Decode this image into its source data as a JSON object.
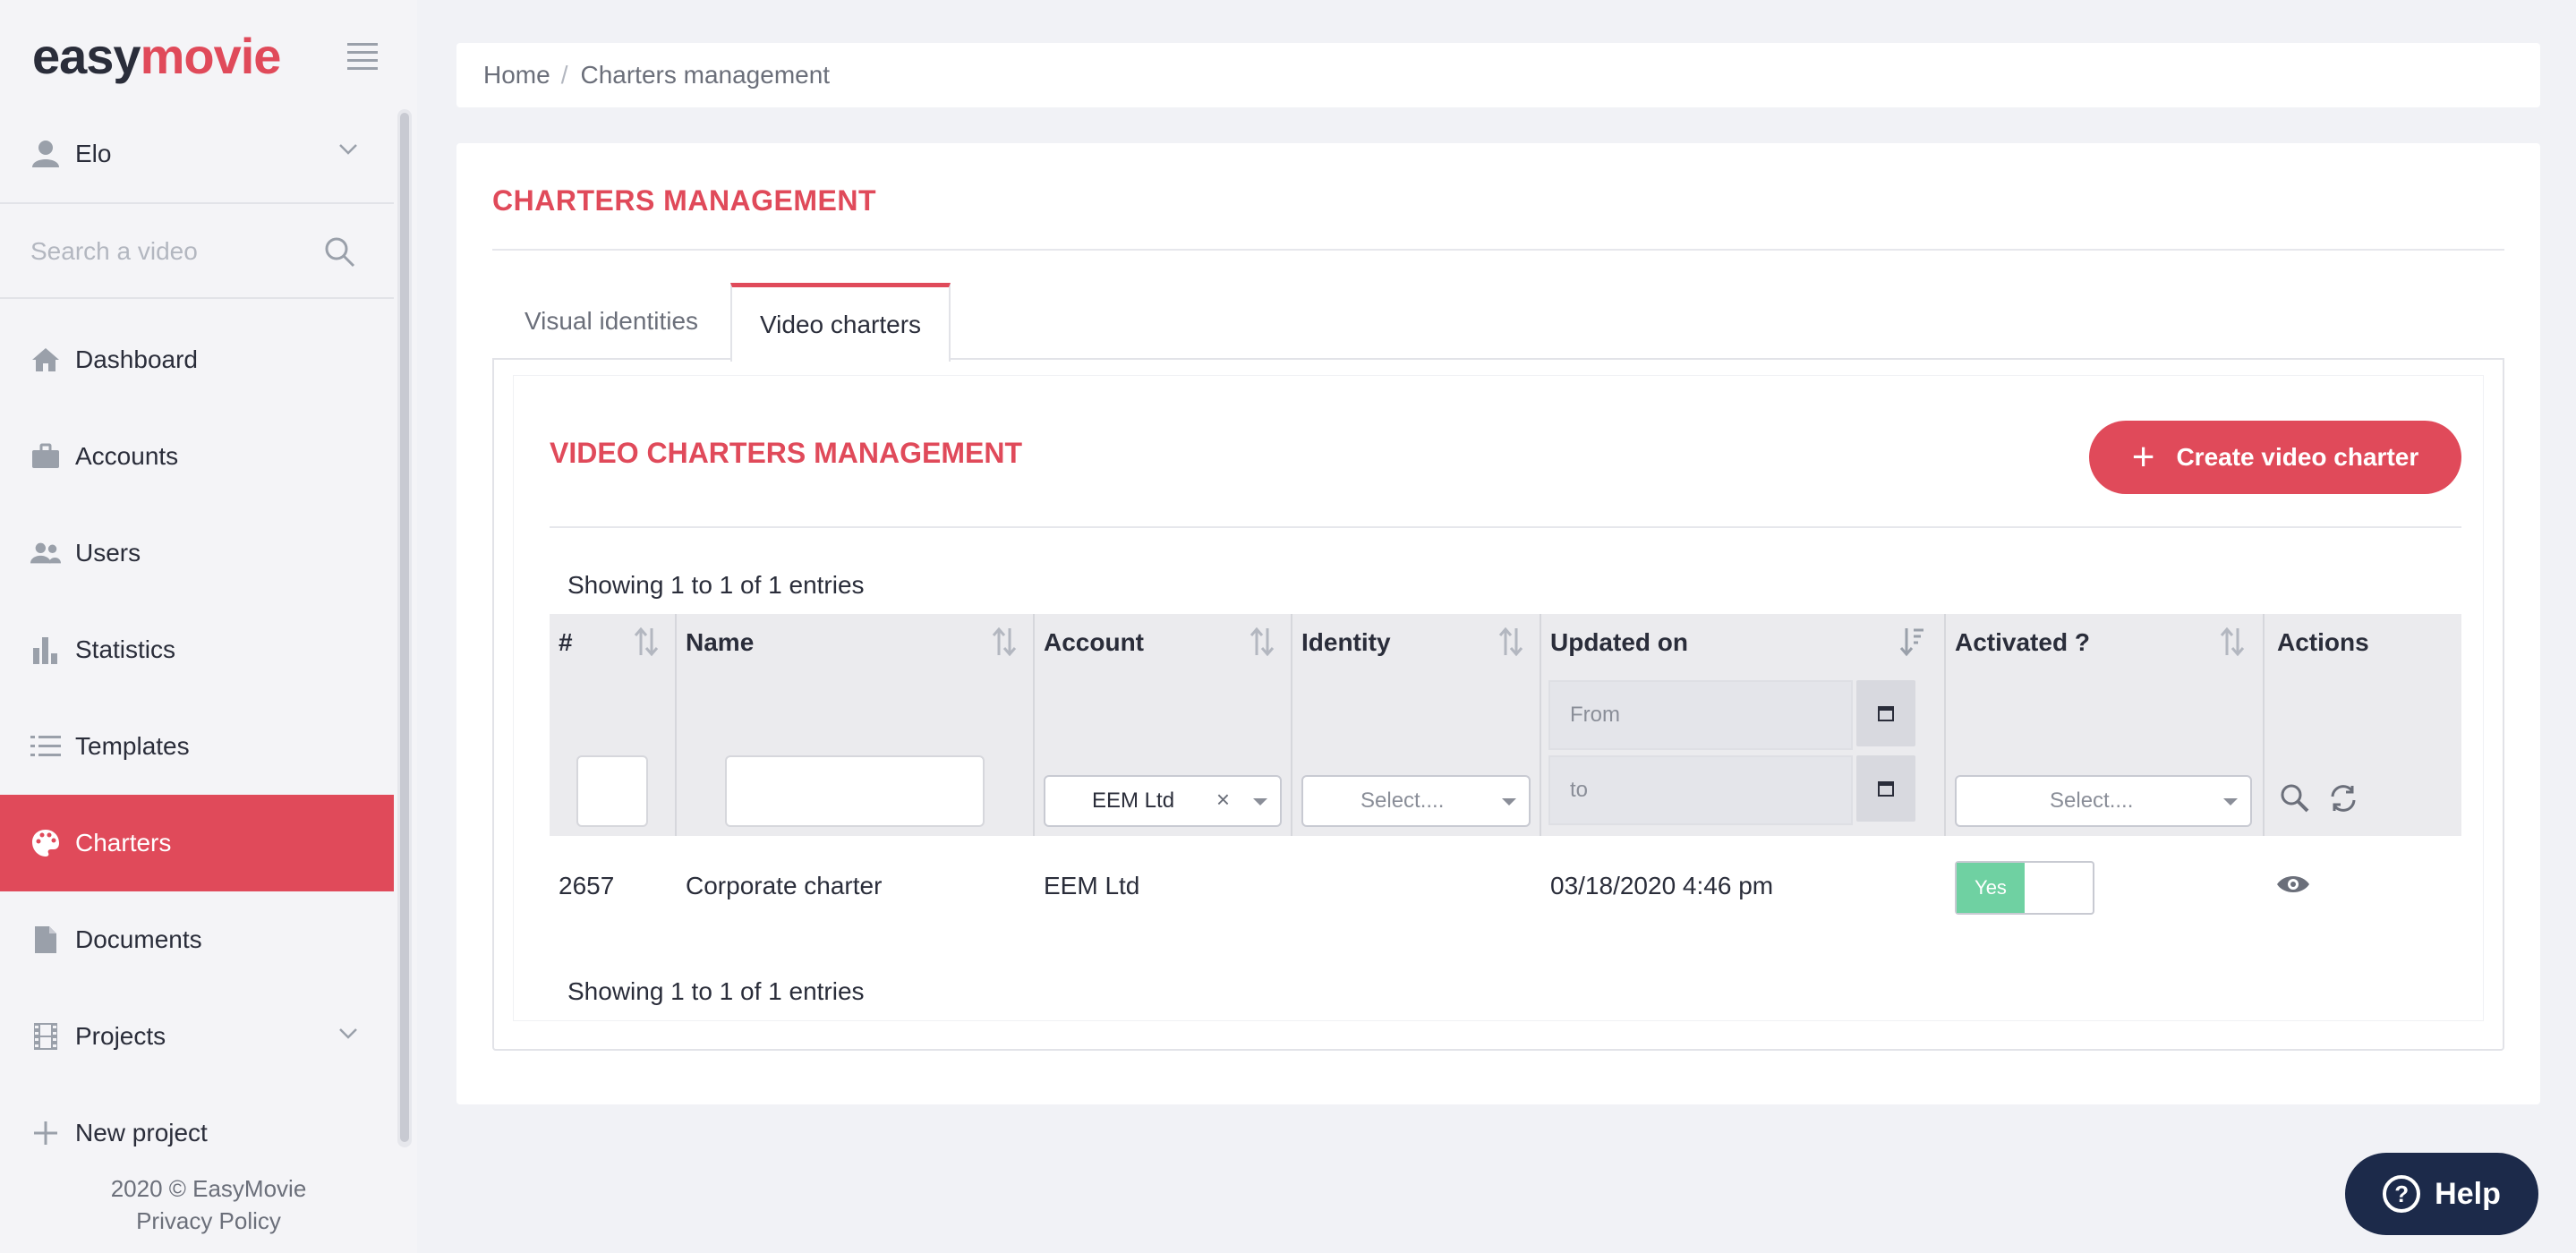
{
  "app": {
    "logo_easy": "easy",
    "logo_movie": "movie",
    "brand_color": "#e04a5a"
  },
  "sidebar": {
    "user": {
      "name": "Elo",
      "icon": "user-icon"
    },
    "search": {
      "placeholder": "Search a video",
      "value": ""
    },
    "items": [
      {
        "label": "Dashboard",
        "icon": "home-icon",
        "active": false
      },
      {
        "label": "Accounts",
        "icon": "briefcase-icon",
        "active": false
      },
      {
        "label": "Users",
        "icon": "users-icon",
        "active": false
      },
      {
        "label": "Statistics",
        "icon": "bar-chart-icon",
        "active": false
      },
      {
        "label": "Templates",
        "icon": "list-icon",
        "active": false
      },
      {
        "label": "Charters",
        "icon": "palette-icon",
        "active": true
      },
      {
        "label": "Documents",
        "icon": "document-icon",
        "active": false
      },
      {
        "label": "Projects",
        "icon": "film-icon",
        "active": false
      },
      {
        "label": "New project",
        "icon": "plus-icon",
        "active": false
      }
    ],
    "footer_copyright": "2020 © EasyMovie",
    "footer_privacy": "Privacy Policy"
  },
  "breadcrumb": {
    "home": "Home",
    "separator": "/",
    "current": "Charters management"
  },
  "main": {
    "title": "CHARTERS MANAGEMENT",
    "tabs": [
      {
        "label": "Visual identities",
        "active": false
      },
      {
        "label": "Video charters",
        "active": true
      }
    ],
    "section_title": "VIDEO CHARTERS MANAGEMENT",
    "create_button": "Create video charter",
    "entries_top": "Showing 1 to 1 of 1 entries",
    "entries_bottom": "Showing 1 to 1 of 1 entries",
    "table": {
      "columns": [
        "#",
        "Name",
        "Account",
        "Identity",
        "Updated on",
        "Activated ?",
        "Actions"
      ],
      "filters": {
        "id_value": "",
        "name_value": "",
        "account_value": "EEM Ltd",
        "account_clear": "×",
        "identity_placeholder": "Select....",
        "updated_from_placeholder": "From",
        "updated_to_placeholder": "to",
        "activated_placeholder": "Select...."
      },
      "rows": [
        {
          "id": "2657",
          "name": "Corporate charter",
          "account": "EEM Ltd",
          "identity": "",
          "updated_on": "03/18/2020 4:46 pm",
          "activated": "Yes"
        }
      ]
    }
  },
  "help_button": "Help"
}
